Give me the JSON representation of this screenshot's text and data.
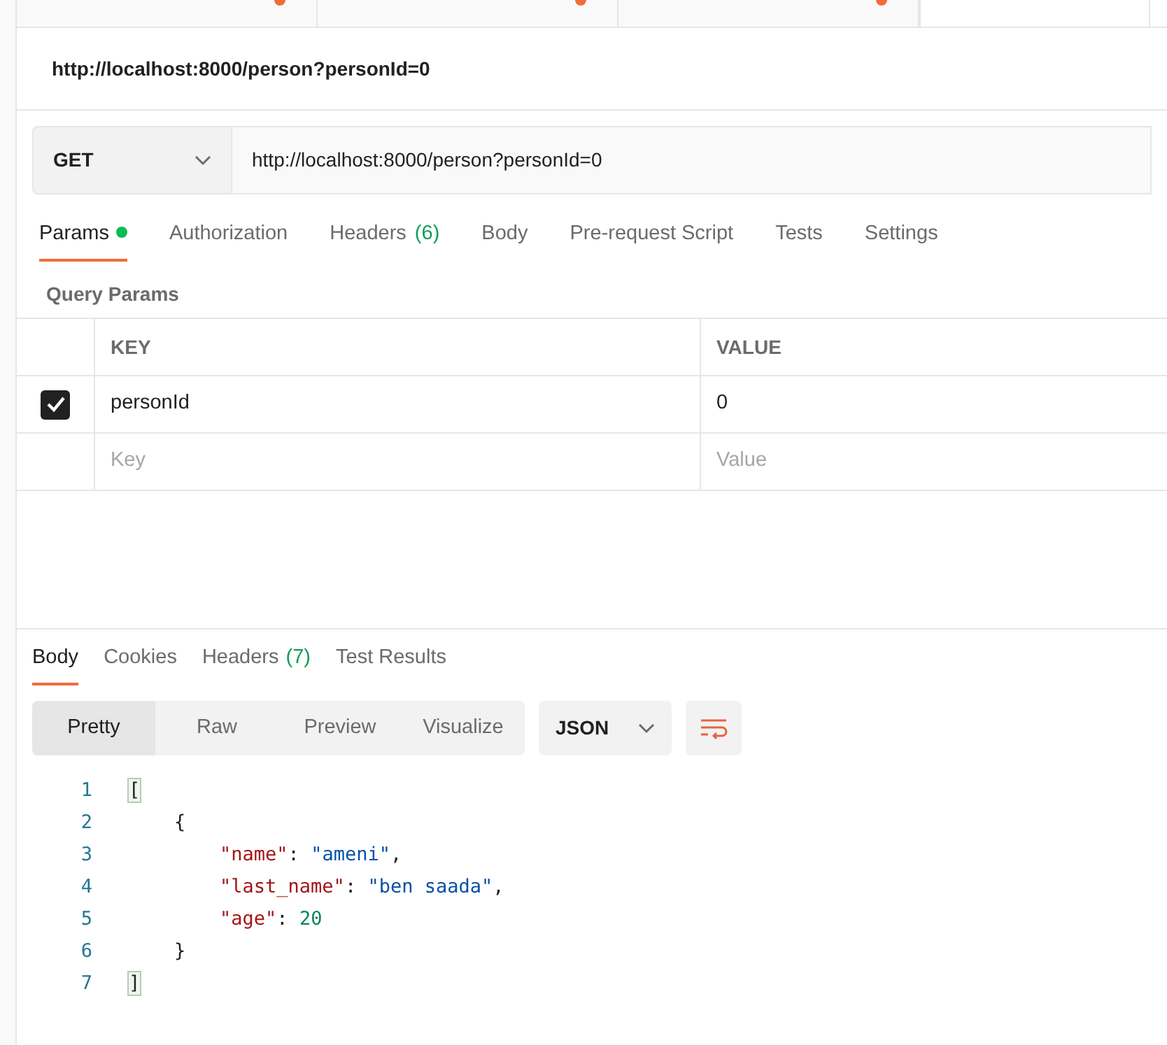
{
  "browser_tabs": [
    {
      "selected": false
    },
    {
      "selected": false
    },
    {
      "selected": false
    },
    {
      "selected": true
    }
  ],
  "request_title": "http://localhost:8000/person?personId=0",
  "request": {
    "method": "GET",
    "url": "http://localhost:8000/person?personId=0"
  },
  "request_tabs": [
    {
      "label": "Params",
      "dot": true,
      "selected": true
    },
    {
      "label": "Authorization",
      "dot": false,
      "selected": false
    },
    {
      "label": "Headers",
      "count": "(6)",
      "dot": false,
      "selected": false
    },
    {
      "label": "Body",
      "dot": false,
      "selected": false
    },
    {
      "label": "Pre-request Script",
      "dot": false,
      "selected": false
    },
    {
      "label": "Tests",
      "dot": false,
      "selected": false
    },
    {
      "label": "Settings",
      "dot": false,
      "selected": false
    }
  ],
  "query_params": {
    "title": "Query Params",
    "columns": [
      "KEY",
      "VALUE"
    ],
    "rows": [
      {
        "key": "personId",
        "value": "0",
        "checked": true
      }
    ],
    "key_placeholder": "Key",
    "value_placeholder": "Value"
  },
  "response_tabs": [
    {
      "label": "Body",
      "selected": true
    },
    {
      "label": "Cookies",
      "selected": false
    },
    {
      "label": "Headers",
      "count": "(7)",
      "selected": false
    },
    {
      "label": "Test Results",
      "selected": false
    }
  ],
  "view_modes": [
    {
      "label": "Pretty",
      "selected": true
    },
    {
      "label": "Raw",
      "selected": false
    },
    {
      "label": "Preview",
      "selected": false
    },
    {
      "label": "Visualize",
      "selected": false
    }
  ],
  "format": "JSON",
  "code_lines": [
    {
      "number": "1",
      "tokens": [
        {
          "kind": "bracket",
          "text": "["
        }
      ]
    },
    {
      "number": "2",
      "tokens": [
        {
          "kind": "plain",
          "text": "    {"
        }
      ]
    },
    {
      "number": "3",
      "tokens": [
        {
          "kind": "key",
          "text": "        \"name\""
        },
        {
          "kind": "plain",
          "text": ": "
        },
        {
          "kind": "string",
          "text": "\"ameni\""
        },
        {
          "kind": "plain",
          "text": ","
        }
      ]
    },
    {
      "number": "4",
      "tokens": [
        {
          "kind": "key",
          "text": "        \"last_name\""
        },
        {
          "kind": "plain",
          "text": ": "
        },
        {
          "kind": "string",
          "text": "\"ben saada\""
        },
        {
          "kind": "plain",
          "text": ","
        }
      ]
    },
    {
      "number": "5",
      "tokens": [
        {
          "kind": "key",
          "text": "        \"age\""
        },
        {
          "kind": "plain",
          "text": ": "
        },
        {
          "kind": "number",
          "text": "20"
        }
      ]
    },
    {
      "number": "6",
      "tokens": [
        {
          "kind": "plain",
          "text": "    }"
        }
      ]
    },
    {
      "number": "7",
      "tokens": [
        {
          "kind": "bracket",
          "text": "]"
        }
      ]
    }
  ]
}
